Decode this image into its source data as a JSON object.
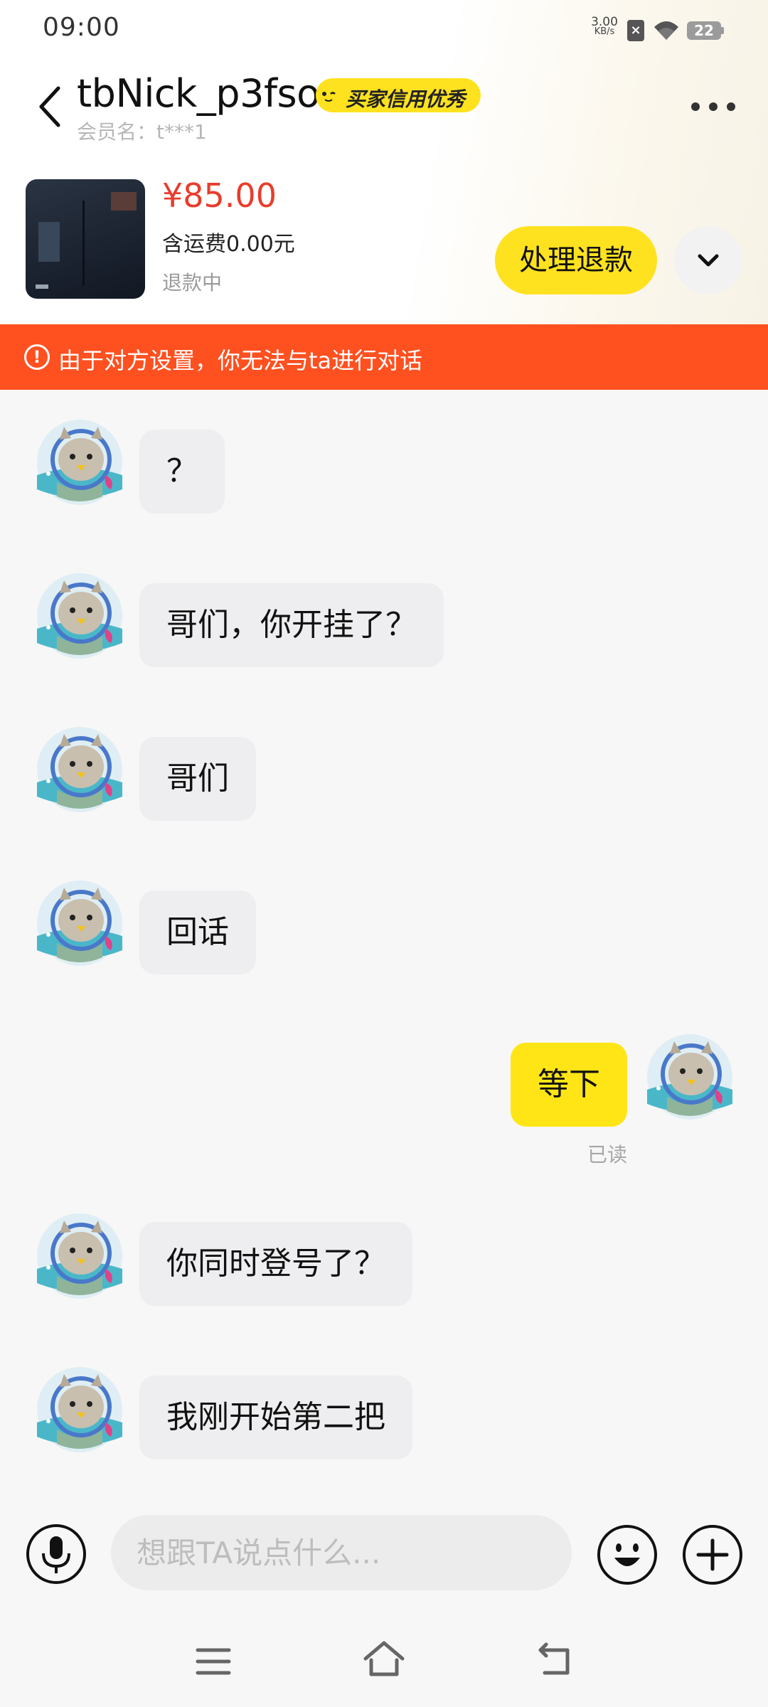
{
  "status_bar": {
    "time": "09:00",
    "net_speed_value": "3.00",
    "net_speed_unit": "KB/s",
    "battery_level": "22"
  },
  "header": {
    "nickname": "tbNick_p3fso",
    "credit_badge": "买家信用优秀",
    "member_name": "会员名：t***1"
  },
  "product": {
    "price": "¥85.00",
    "shipping": "含运费0.00元",
    "status": "退款中",
    "refund_button": "处理退款"
  },
  "warning_banner": {
    "icon_text": "!",
    "text": "由于对方设置，你无法与ta进行对话"
  },
  "messages": [
    {
      "text": "？",
      "direction": "incoming"
    },
    {
      "text": "哥们，你开挂了？",
      "direction": "incoming"
    },
    {
      "text": "哥们",
      "direction": "incoming"
    },
    {
      "text": "回话",
      "direction": "incoming"
    },
    {
      "text": "等下",
      "direction": "outgoing",
      "read_status": "已读"
    },
    {
      "text": "你同时登号了？",
      "direction": "incoming"
    },
    {
      "text": "我刚开始第二把",
      "direction": "incoming"
    }
  ],
  "input_bar": {
    "placeholder": "想跟TA说点什么..."
  },
  "icons": {
    "back": "back-icon",
    "more": "more-icon",
    "expand": "chevron-down-icon",
    "voice": "microphone-icon",
    "emoji": "emoji-icon",
    "plus": "plus-icon",
    "nav_menu": "menu-icon",
    "nav_home": "home-icon",
    "nav_back": "back-arrow-icon"
  },
  "colors": {
    "accent_yellow": "#ffe21f",
    "price_red": "#e83d2c",
    "warning_orange": "#ff5020",
    "incoming_bubble": "#eeeef0",
    "outgoing_bubble": "#ffe516"
  }
}
